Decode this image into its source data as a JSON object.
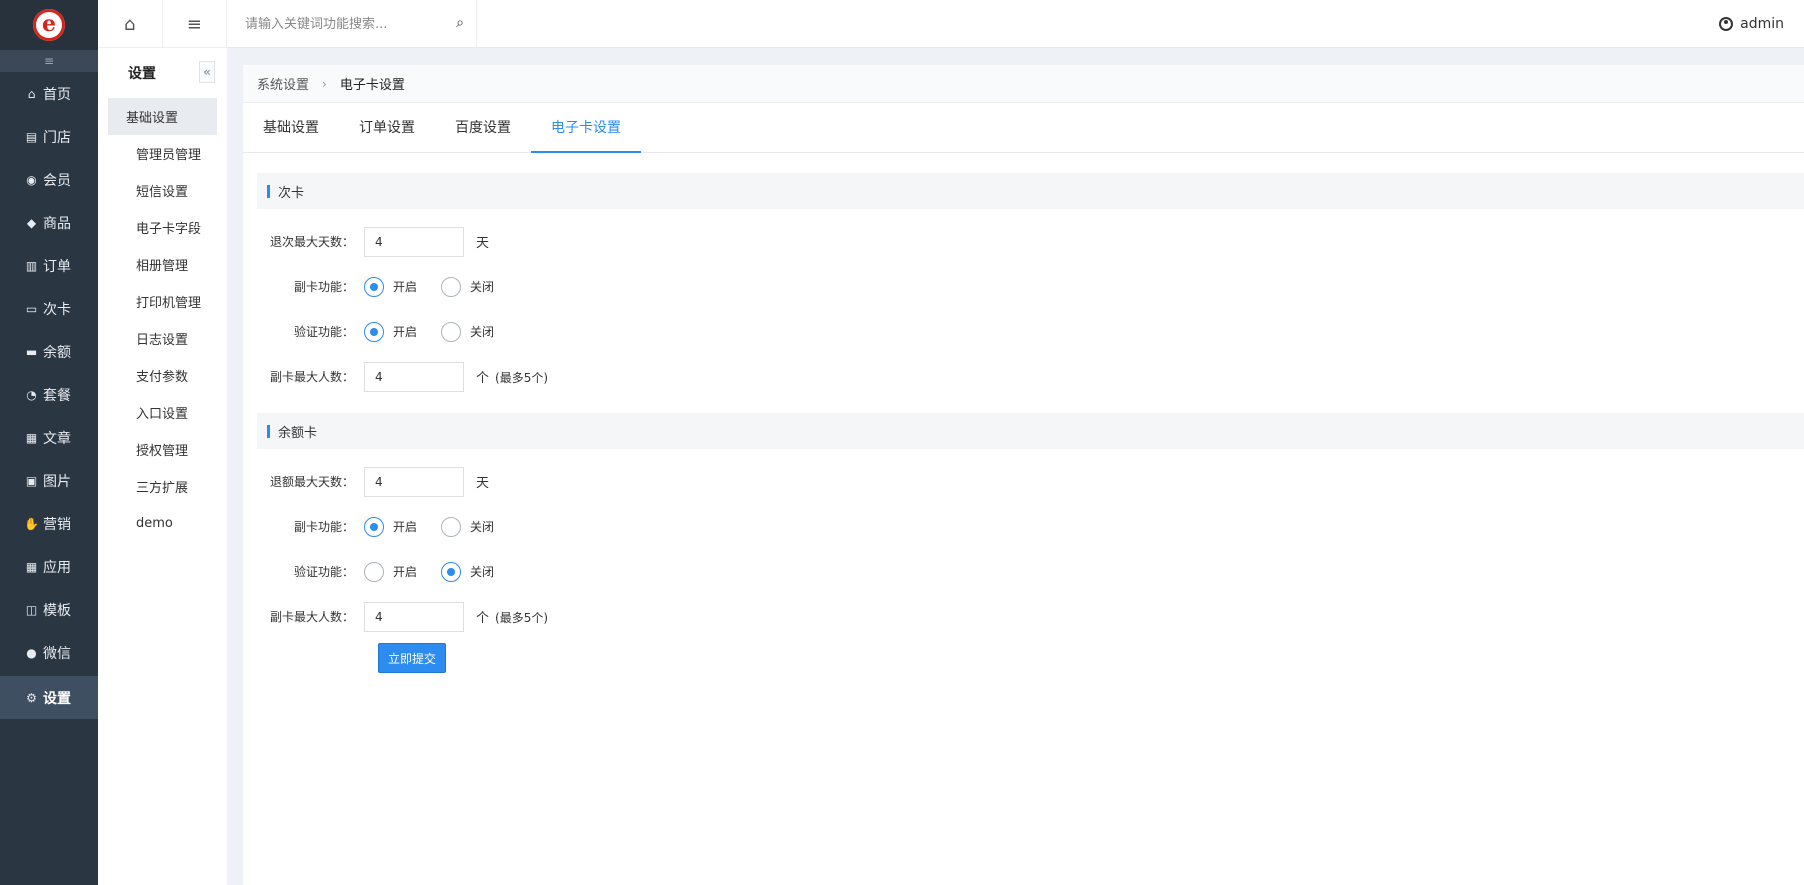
{
  "logo": {
    "letter": "e"
  },
  "nav": {
    "collapse_icon": "≡",
    "items": [
      {
        "label": "首页",
        "icon": "home-icon",
        "glyph": "⌂"
      },
      {
        "label": "门店",
        "icon": "store-icon",
        "glyph": "▤"
      },
      {
        "label": "会员",
        "icon": "member-icon",
        "glyph": "◉"
      },
      {
        "label": "商品",
        "icon": "tag-icon",
        "glyph": "◆"
      },
      {
        "label": "订单",
        "icon": "order-icon",
        "glyph": "▥"
      },
      {
        "label": "次卡",
        "icon": "card-icon",
        "glyph": "▭"
      },
      {
        "label": "余额",
        "icon": "wallet-icon",
        "glyph": "▬"
      },
      {
        "label": "套餐",
        "icon": "dashboard-icon",
        "glyph": "◔"
      },
      {
        "label": "文章",
        "icon": "article-icon",
        "glyph": "▦"
      },
      {
        "label": "图片",
        "icon": "image-icon",
        "glyph": "▣"
      },
      {
        "label": "营销",
        "icon": "thumbs-up-icon",
        "glyph": "✋"
      },
      {
        "label": "应用",
        "icon": "apps-icon",
        "glyph": "▦"
      },
      {
        "label": "模板",
        "icon": "template-icon",
        "glyph": "◫"
      },
      {
        "label": "微信",
        "icon": "wechat-icon",
        "glyph": "●"
      },
      {
        "label": "设置",
        "icon": "settings-icon",
        "glyph": "⚙"
      }
    ],
    "active_index": 14
  },
  "subnav": {
    "home_glyph": "⌂",
    "menu_glyph": "≡",
    "title": "设置",
    "collapse_glyph": "«",
    "items": [
      "基础设置",
      "管理员管理",
      "短信设置",
      "电子卡字段",
      "相册管理",
      "打印机管理",
      "日志设置",
      "支付参数",
      "入口设置",
      "授权管理",
      "三方扩展",
      "demo"
    ],
    "active_index": 0
  },
  "topbar": {
    "search_placeholder": "请输入关键词功能搜索...",
    "search_glyph": "⌕",
    "user": "admin"
  },
  "breadcrumb": {
    "parent": "系统设置",
    "sep": "›",
    "current": "电子卡设置"
  },
  "tabs": [
    {
      "label": "基础设置",
      "active": false
    },
    {
      "label": "订单设置",
      "active": false
    },
    {
      "label": "百度设置",
      "active": false
    },
    {
      "label": "电子卡设置",
      "active": true
    }
  ],
  "sections": {
    "count_card": {
      "title": "次卡",
      "refund_days_label": "退次最大天数：",
      "refund_days_value": "4",
      "refund_days_unit": "天",
      "sub_card_label": "副卡功能：",
      "verify_label": "验证功能：",
      "sub_max_label": "副卡最大人数：",
      "sub_max_value": "4",
      "sub_max_unit": "个",
      "sub_max_hint": "(最多5个)",
      "opt_on": "开启",
      "opt_off": "关闭",
      "sub_card_on": true,
      "verify_on": true
    },
    "balance_card": {
      "title": "余额卡",
      "refund_days_label": "退额最大天数：",
      "refund_days_value": "4",
      "refund_days_unit": "天",
      "sub_card_label": "副卡功能：",
      "verify_label": "验证功能：",
      "sub_max_label": "副卡最大人数：",
      "sub_max_value": "4",
      "sub_max_unit": "个",
      "sub_max_hint": "(最多5个)",
      "opt_on": "开启",
      "opt_off": "关闭",
      "sub_card_on": true,
      "verify_on": false
    }
  },
  "submit_label": "立即提交",
  "colors": {
    "primary": "#2d8cf0",
    "nav_bg": "#2b3643",
    "logo_red": "#d4261d"
  }
}
